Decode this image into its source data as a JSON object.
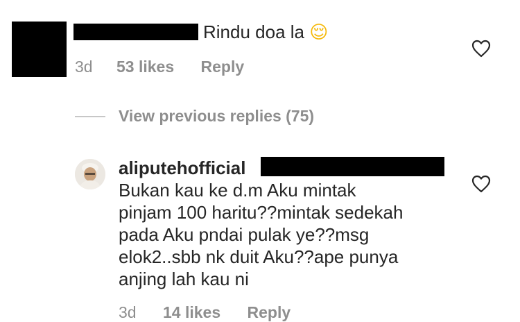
{
  "comment1": {
    "text": "Rindu doa la",
    "emoji": "😌",
    "time": "3d",
    "likes": "53 likes",
    "reply": "Reply"
  },
  "view_replies": {
    "label": "View previous replies (75)"
  },
  "reply1": {
    "username": "aliputehofficial",
    "text_lines": [
      "Bukan kau ke d.m Aku mintak",
      "pinjam 100 haritu??mintak sedekah",
      "pada Aku pndai pulak ye??msg",
      "elok2..sbb nk duit Aku??ape punya",
      "anjing lah kau ni"
    ],
    "time": "3d",
    "likes": "14 likes",
    "reply": "Reply"
  },
  "icons": {
    "like": "heart-outline-icon"
  },
  "colors": {
    "text": "#262626",
    "muted": "#8e8e8e",
    "redaction": "#000000"
  }
}
